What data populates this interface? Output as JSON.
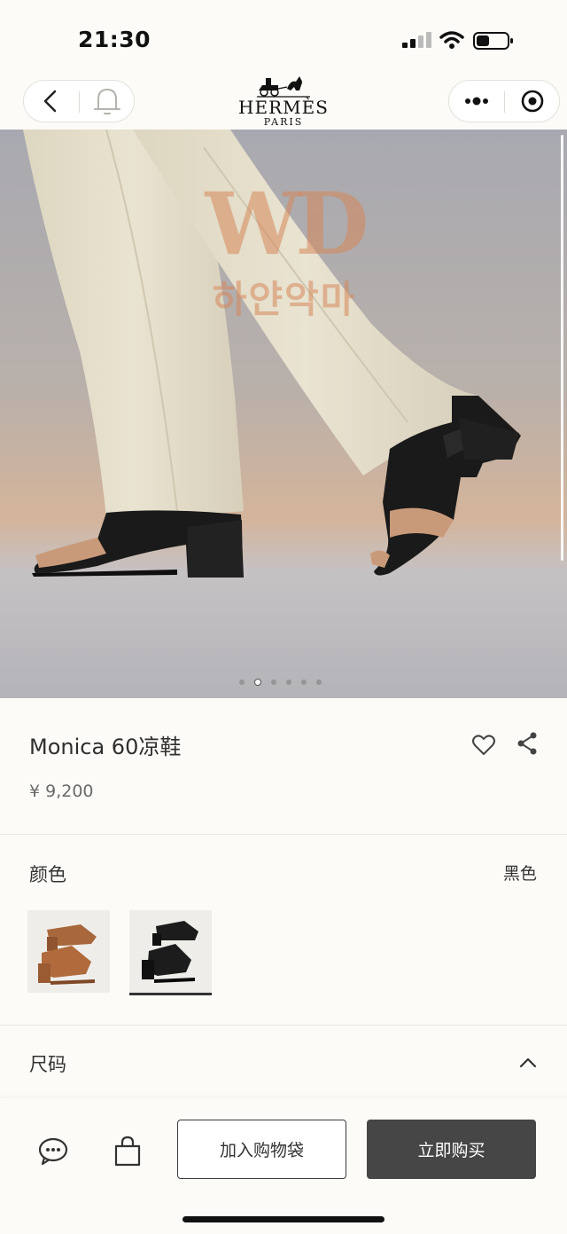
{
  "status_bar": {
    "time": "21:30",
    "signal_icon": "signal-icon",
    "wifi_icon": "wifi-icon",
    "battery_icon": "battery-icon"
  },
  "nav": {
    "back_icon": "chevron-left-icon",
    "bell_icon": "bell-icon",
    "brand_name": "HERMÈS",
    "brand_sub": "PARIS",
    "more_icon": "more-dots-icon",
    "close_icon": "target-close-icon"
  },
  "hero": {
    "watermark_logo": "WD",
    "watermark_text": "하얀악마",
    "slides_total": 6,
    "active_slide": 2
  },
  "product": {
    "title": "Monica 60凉鞋",
    "price": "¥ 9,200",
    "favorite_icon": "heart-icon",
    "share_icon": "share-icon"
  },
  "color": {
    "label": "颜色",
    "selected": "黑色",
    "swatches": [
      {
        "name": "tan",
        "color": "#b06a3c"
      },
      {
        "name": "black",
        "color": "#1c1c1c"
      }
    ]
  },
  "size": {
    "label": "尺码",
    "toggle_icon": "chevron-up-icon"
  },
  "actions": {
    "chat_icon": "chat-icon",
    "bag_icon": "shopping-bag-icon",
    "add_to_bag": "加入购物袋",
    "buy_now": "立即购买"
  },
  "colors": {
    "background": "#fcfbf7",
    "buy_button": "#464646",
    "pants": "#e3dcc8",
    "shoe": "#1a1a1a"
  }
}
